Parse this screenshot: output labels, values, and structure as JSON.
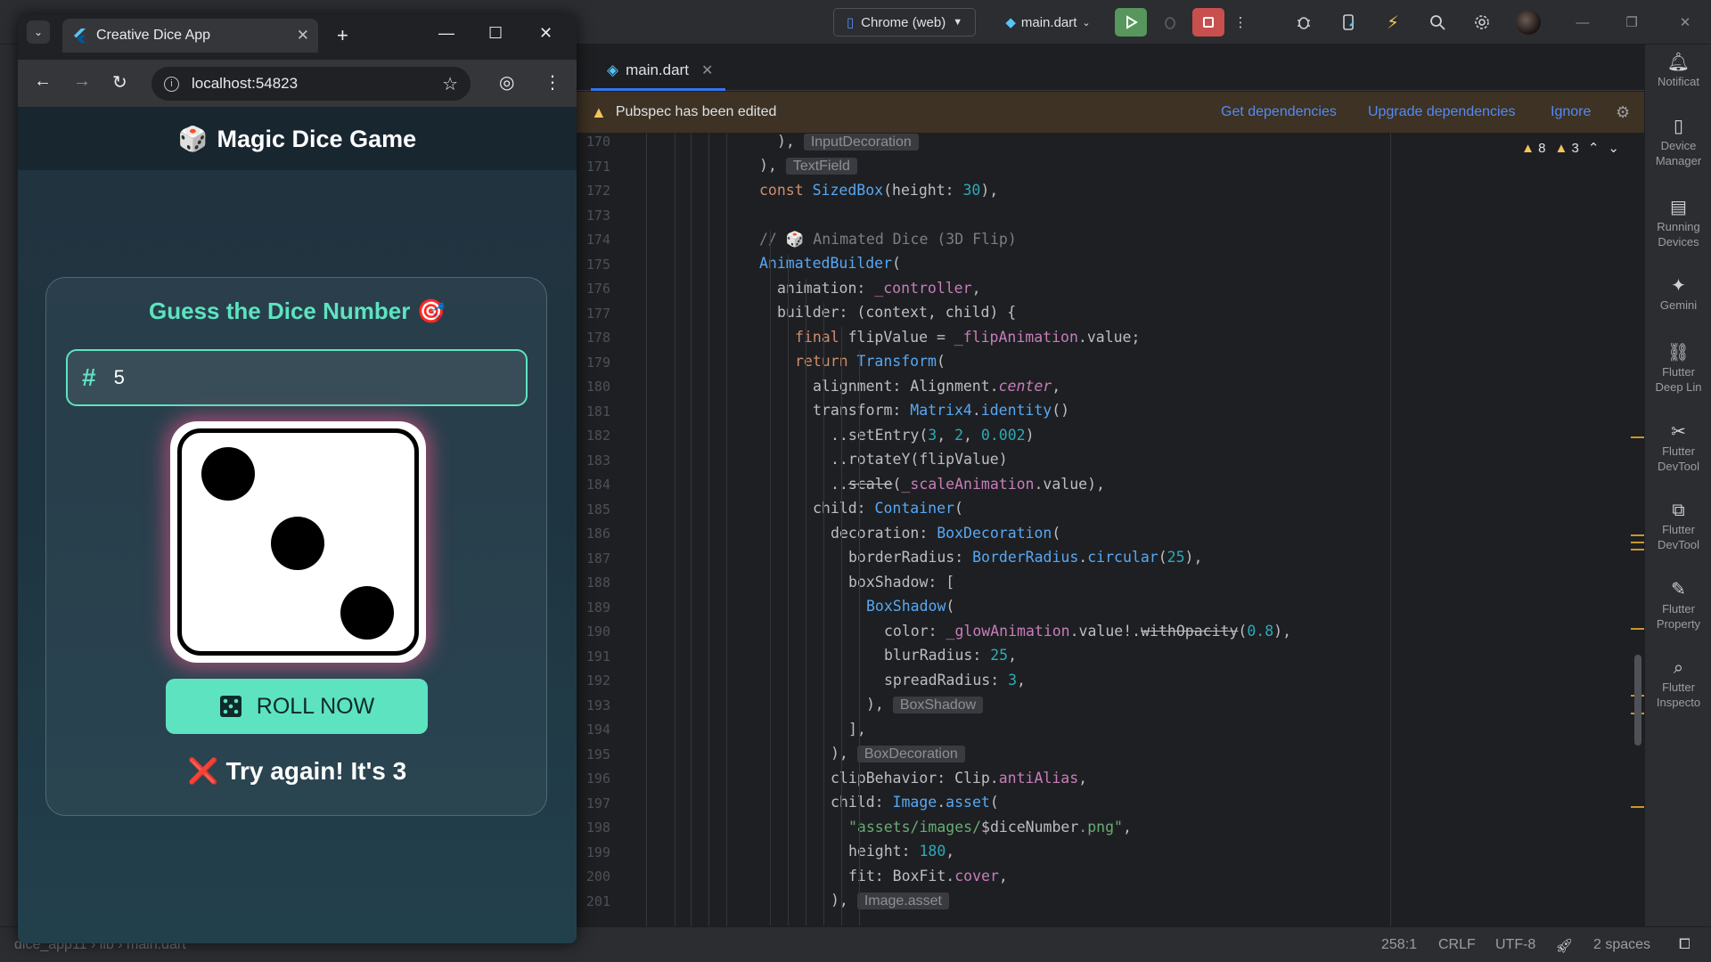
{
  "ide": {
    "device_select": "Chrome (web)",
    "run_config": "main.dart",
    "editor_tab": "main.dart",
    "banner": {
      "message": "Pubspec has been edited",
      "get_deps": "Get dependencies",
      "upgrade_deps": "Upgrade dependencies",
      "ignore": "Ignore"
    },
    "warnings": {
      "warn_count": "8",
      "weak_count": "3"
    },
    "gutter": [
      "170",
      "171",
      "172",
      "173",
      "174",
      "175",
      "176",
      "177",
      "178",
      "179",
      "180",
      "181",
      "182",
      "183",
      "184",
      "185",
      "186",
      "187",
      "188",
      "189",
      "190",
      "191",
      "192",
      "193",
      "194",
      "195",
      "196",
      "197",
      "198",
      "199",
      "200",
      "201"
    ],
    "right_tools": [
      {
        "label": "Notificat"
      },
      {
        "label": "Device Manager"
      },
      {
        "label": "Running Devices"
      },
      {
        "label": "Gemini"
      },
      {
        "label": "Flutter Deep Lin"
      },
      {
        "label": "Flutter DevTool"
      },
      {
        "label": "Flutter DevTool"
      },
      {
        "label": "Flutter Property"
      },
      {
        "label": "Flutter Inspecto"
      }
    ],
    "status": {
      "breadcrumb": "dice_app11 › lib › main.dart",
      "position": "258:1",
      "line_sep": "CRLF",
      "encoding": "UTF-8",
      "indent": "2 spaces"
    },
    "colors": {
      "accent": "#3574f0",
      "run_green": "#57965c",
      "stop_red": "#c94f4f",
      "warning": "#f2c55c"
    }
  },
  "browser": {
    "tab_title": "Creative Dice App",
    "address": "localhost:54823"
  },
  "app": {
    "header_emoji": "🎲",
    "header_title": "Magic Dice Game",
    "card_title": "Guess the Dice Number 🎯",
    "guess_value": "5",
    "dice_value": 3,
    "roll_label": "ROLL NOW",
    "result_text": "❌ Try again! It's 3",
    "colors": {
      "accent": "#5de3c0",
      "glow": "#f55a8c"
    }
  }
}
